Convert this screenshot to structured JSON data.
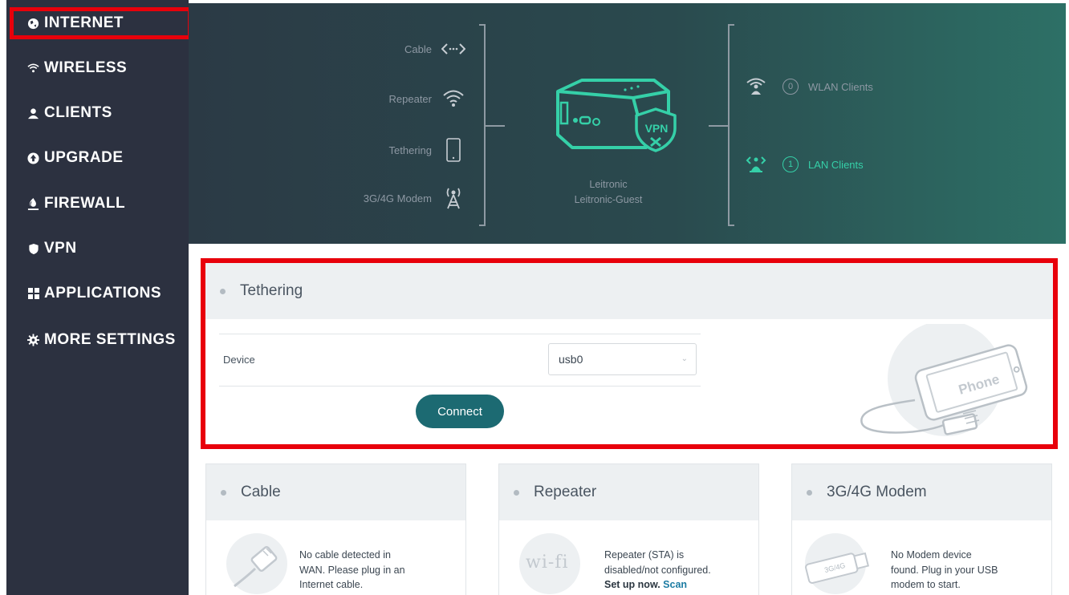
{
  "sidebar": {
    "items": [
      {
        "label": "INTERNET",
        "icon": "globe-icon"
      },
      {
        "label": "WIRELESS",
        "icon": "wifi-icon"
      },
      {
        "label": "CLIENTS",
        "icon": "user-icon"
      },
      {
        "label": "UPGRADE",
        "icon": "upload-icon"
      },
      {
        "label": "FIREWALL",
        "icon": "flame-icon"
      },
      {
        "label": "VPN",
        "icon": "shield-icon"
      },
      {
        "label": "APPLICATIONS",
        "icon": "grid-icon"
      },
      {
        "label": "MORE SETTINGS",
        "icon": "gear-icon"
      }
    ]
  },
  "hero": {
    "sources": [
      {
        "label": "Cable",
        "icon": "cable-icon"
      },
      {
        "label": "Repeater",
        "icon": "wifi-icon"
      },
      {
        "label": "Tethering",
        "icon": "phone-icon"
      },
      {
        "label": "3G/4G Modem",
        "icon": "antenna-icon"
      }
    ],
    "router": {
      "line1": "Leitronic",
      "line2": "Leitronic-Guest",
      "vpn_label": "VPN"
    },
    "clients": [
      {
        "count": "0",
        "label": "WLAN Clients",
        "color": "#8d98a3"
      },
      {
        "count": "1",
        "label": "LAN Clients",
        "color": "#35d0a8"
      }
    ]
  },
  "tethering": {
    "title": "Tethering",
    "device_label": "Device",
    "device_value": "usb0",
    "connect_label": "Connect",
    "phone_text": "Phone"
  },
  "cards": {
    "cable": {
      "title": "Cable",
      "line1": "No cable detected in",
      "line2": "WAN. Please plug in an",
      "line3": "Internet cable."
    },
    "repeater": {
      "title": "Repeater",
      "line1": "Repeater (STA) is",
      "line2": "disabled/not configured.",
      "setup": "Set up now.",
      "scan": "Scan",
      "icon_text": "wi-fi"
    },
    "modem": {
      "title": "3G/4G Modem",
      "line1": "No Modem device",
      "line2": "found. Plug in your USB",
      "line3": "modem to start.",
      "icon_text": "3G/4G"
    }
  },
  "colors": {
    "accent": "#35d0a8",
    "highlight": "#e8000b",
    "button": "#1c6a72",
    "sidebar": "#2c3140"
  }
}
